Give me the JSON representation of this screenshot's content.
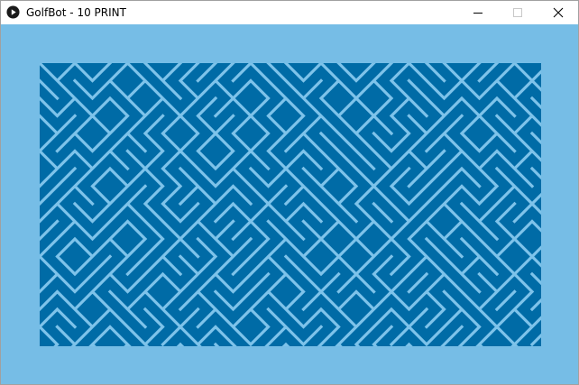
{
  "window": {
    "title": "GolfBot - 10 PRINT",
    "icons": {
      "app": "play-circle-icon",
      "minimize": "minimize-icon",
      "maximize": "maximize-icon",
      "close": "close-icon"
    }
  },
  "canvas": {
    "pattern": "10 PRINT diagonal maze",
    "colors": {
      "background": "#76bde6",
      "panel": "#006ba6",
      "lines": "#7ec3ea"
    }
  }
}
